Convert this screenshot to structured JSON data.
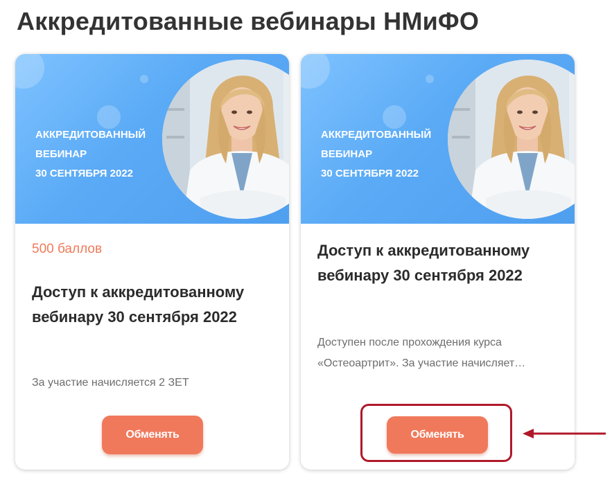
{
  "page": {
    "title": "Аккредитованные вебинары НМиФО"
  },
  "cards": [
    {
      "banner": {
        "line1": "Аккредитованный",
        "line2": "вебинар",
        "line3": "30 сентября 2022"
      },
      "points": "500 баллов",
      "title": "Доступ к аккредитованному вебинару 30 сентября 2022",
      "description": "За участие начисляется 2 ЗЕТ",
      "button_label": "Обменять"
    },
    {
      "banner": {
        "line1": "Аккредитованный",
        "line2": "вебинар",
        "line3": "30 сентября 2022"
      },
      "title": "Доступ к аккредитованному вебинару 30 сентября 2022",
      "description": "Доступен после прохождения курса «Остеоартрит». За участие начисляет…",
      "button_label": "Обменять"
    }
  ],
  "colors": {
    "accent": "#f0795c",
    "banner_blue": "#5aaaf6",
    "highlight_red": "#b0182a",
    "title_text": "#333333"
  },
  "icons": [
    "pharmacist-photo",
    "arrow-left-icon"
  ]
}
